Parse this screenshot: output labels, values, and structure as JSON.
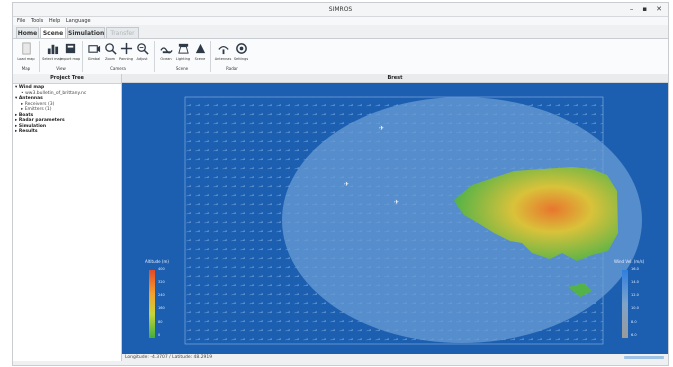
{
  "window": {
    "title": "SIMROS"
  },
  "menu": [
    "File",
    "Tools",
    "Help",
    "Language"
  ],
  "tabs": [
    {
      "label": "Home",
      "state": "normal"
    },
    {
      "label": "Scene",
      "state": "active"
    },
    {
      "label": "Simulation",
      "state": "normal"
    },
    {
      "label": "Transfer",
      "state": "disabled"
    }
  ],
  "ribbon": {
    "groups": [
      {
        "name": "Map",
        "buttons": [
          "Load map"
        ]
      },
      {
        "name": "View",
        "buttons": [
          "Select map",
          "Import map"
        ]
      },
      {
        "name": "Camera",
        "buttons": [
          "Gimbal",
          "Zoom",
          "Panning",
          "Adjust"
        ]
      },
      {
        "name": "Scene",
        "buttons": [
          "Ocean",
          "Lighting",
          "Scene"
        ]
      },
      {
        "name": "Radar",
        "buttons": [
          "Antennas",
          "Settings"
        ]
      }
    ]
  },
  "project_tree": {
    "title": "Project Tree",
    "items": [
      {
        "label": "Wind map",
        "level": 0
      },
      {
        "label": "ww3.bulletin_of_brittany.nc",
        "level": 1
      },
      {
        "label": "Antennas",
        "level": 0
      },
      {
        "label": "Receivers (3)",
        "level": 1
      },
      {
        "label": "Emitters (1)",
        "level": 1
      },
      {
        "label": "Boats",
        "level": 0
      },
      {
        "label": "Radar parameters",
        "level": 0
      },
      {
        "label": "Simulation",
        "level": 0
      },
      {
        "label": "Results",
        "level": 0
      }
    ]
  },
  "view": {
    "title": "Brest"
  },
  "legend_altitude": {
    "title": "Altitude (m)",
    "ticks": [
      "400",
      "320",
      "240",
      "160",
      "80",
      "0"
    ]
  },
  "legend_wind": {
    "title": "Wind Vel. (m/s)",
    "ticks": [
      "16.0",
      "14.0",
      "12.0",
      "10.0",
      "8.0",
      "6.0"
    ]
  },
  "status": {
    "text": "Longitude: -4.3707 / Latitude: 48.2919"
  },
  "colors": {
    "sea": "#1c5fb0",
    "coverage": "#6a9cd6",
    "land_low": "#54b348",
    "land_high": "#e8762e"
  }
}
